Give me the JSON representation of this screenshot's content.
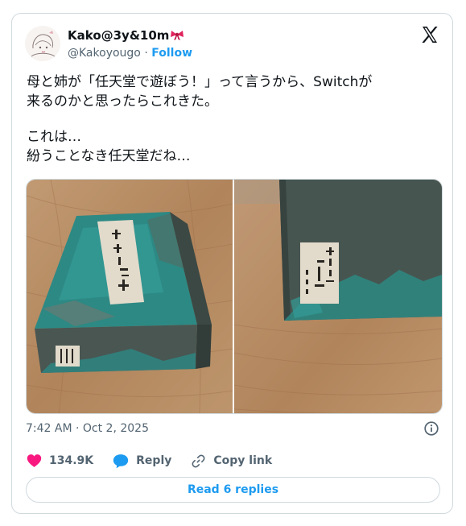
{
  "author": {
    "display_name": "Kako@3y&10m",
    "handle": "@Kakoyougo",
    "separator": "·",
    "follow_label": "Follow",
    "badge_icon": "ribbon-emoji"
  },
  "tweet": {
    "lines": [
      "母と姉が「任天堂で遊ぼう！」って言うから、Switchが",
      "来るのかと思ったらこれきた。",
      "",
      "これは…",
      "紛うことなき任天堂だね…"
    ],
    "timestamp": "7:42 AM · Oct 2, 2025"
  },
  "media": {
    "photo_count": 2,
    "box_label_chars": [
      "小倉百人一首",
      "嵯峨"
    ],
    "box_side_label_chars": [
      "小倉百人一首",
      "嵯峨",
      "任天堂"
    ]
  },
  "actions": {
    "likes": "134.9K",
    "reply_label": "Reply",
    "copy_link_label": "Copy link"
  },
  "footer": {
    "read_replies_label": "Read 6 replies"
  },
  "colors": {
    "accent": "#1d9bf0",
    "like": "#f91880",
    "text": "#0f1419",
    "muted": "#536471",
    "border": "#cfd9de"
  }
}
